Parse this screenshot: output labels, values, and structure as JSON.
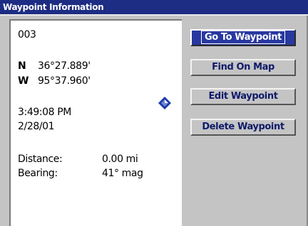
{
  "window": {
    "title": "Waypoint Information"
  },
  "waypoint": {
    "name": "003",
    "lat_prefix": "N",
    "lat_value": "36°27.889'",
    "lon_prefix": "W",
    "lon_value": "95°37.960'",
    "time": "3:49:08 PM",
    "date": "2/28/01",
    "distance_label": "Distance:",
    "distance_value": "0.00 mi",
    "bearing_label": "Bearing:",
    "bearing_value": "41° mag",
    "icon": "waypoint-arrow-icon"
  },
  "buttons": {
    "go_to": "Go To Waypoint",
    "find_on_map": "Find On Map",
    "edit": "Edit Waypoint",
    "delete": "Delete Waypoint"
  },
  "colors": {
    "title_bar": "#1d2d84",
    "active_button": "#2838a0",
    "button_text": "#0f1a6a",
    "window_bg": "#c4c4c4"
  }
}
